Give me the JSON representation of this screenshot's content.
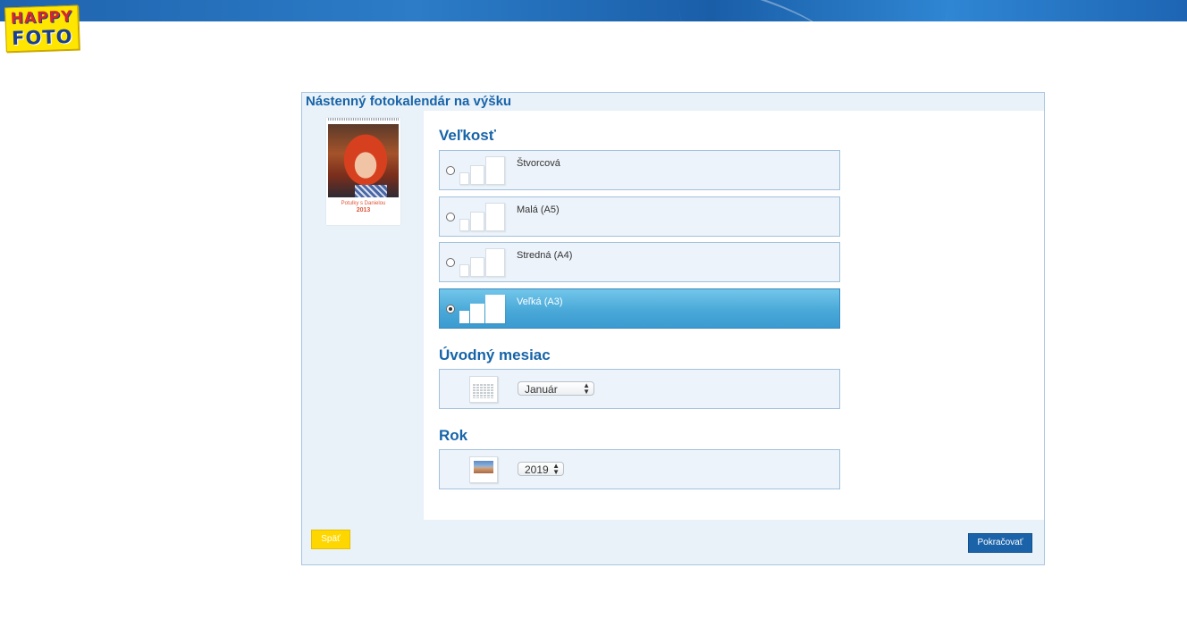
{
  "brand": {
    "logo_line1": "HAPPY",
    "logo_line2": "FOTO",
    "colors": {
      "header_blue": "#2c7cc8",
      "logo_yellow": "#ffe600",
      "accent_blue": "#1764a8"
    }
  },
  "panel": {
    "title": "Nástenný fotokalendár na výšku"
  },
  "preview": {
    "caption": "Potulky s Danielou",
    "year": "2013"
  },
  "size_section": {
    "heading": "Veľkosť",
    "options": [
      {
        "label": "Štvorcová",
        "selected": false
      },
      {
        "label": "Malá (A5)",
        "selected": false
      },
      {
        "label": "Stredná (A4)",
        "selected": false
      },
      {
        "label": "Veľká (A3)",
        "selected": true
      }
    ]
  },
  "month_section": {
    "heading": "Úvodný mesiac",
    "selected": "Január",
    "icon": "calendar-icon"
  },
  "year_section": {
    "heading": "Rok",
    "selected": "2019",
    "icon": "photo-calendar-icon"
  },
  "footer": {
    "back_label": "Späť",
    "next_label": "Pokračovať"
  }
}
